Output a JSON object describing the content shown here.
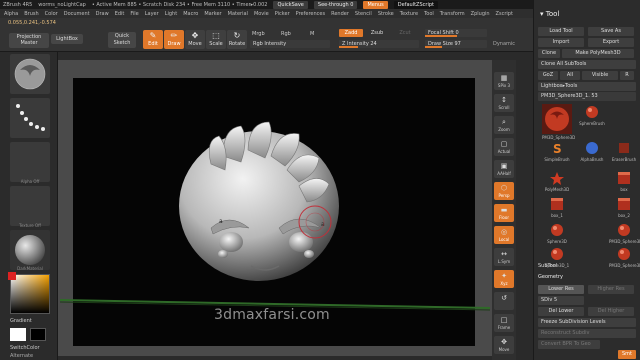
{
  "titlebar": {
    "app": "ZBrush 4R5",
    "doc": "worms_noLightCap",
    "mem": "• Active Mem 885 • Scratch Disk 234 • Free Mem 3110 • Timer▸0.002",
    "quicksave": "QuickSave",
    "seethrough": "See-through 0",
    "menus": "Menus",
    "script": "DefaultZScript"
  },
  "menubar": [
    "Alpha",
    "Brush",
    "Color",
    "Document",
    "Draw",
    "Edit",
    "File",
    "Layer",
    "Light",
    "Macro",
    "Marker",
    "Material",
    "Movie",
    "Picker",
    "Preferences",
    "Render",
    "Stencil",
    "Stroke",
    "Texture",
    "Tool",
    "Transform",
    "Zplugin",
    "Zscript"
  ],
  "coords": "0.055,0.241,-0.574",
  "shelf": {
    "projection_master": "Projection Master",
    "lightbox": "LightBox",
    "quick_sketch": "Quick Sketch",
    "tools": [
      {
        "label": "Edit",
        "icon": "✎",
        "active": true
      },
      {
        "label": "Draw",
        "icon": "✏",
        "active": true
      },
      {
        "label": "Move",
        "icon": "✥",
        "active": false
      },
      {
        "label": "Scale",
        "icon": "⬚",
        "active": false
      },
      {
        "label": "Rotate",
        "icon": "↻",
        "active": false
      }
    ],
    "mrgb": "Mrgb",
    "rgb": "Rgb",
    "m": "M",
    "zadd": "Zadd",
    "zsub": "Zsub",
    "zcut": "Zcut",
    "rgb_intensity": "Rgb Intensity",
    "z_intensity": "Z Intensity 24",
    "focal_shift": "Focal Shift 0",
    "draw_size": "Draw Size 97",
    "dynamic": "Dynamic"
  },
  "leftpanel": {
    "alpha_label": "Alpha Off",
    "texture_label": "Texture Off",
    "material_label": "DarkMaterial",
    "gradient": "Gradient",
    "switch_color": "SwitchColor",
    "alternate": "Alternate"
  },
  "rightcol": [
    {
      "label": "SPix 3",
      "icon": "▦",
      "orange": false
    },
    {
      "label": "Scroll",
      "icon": "↕",
      "orange": false
    },
    {
      "label": "Zoom",
      "icon": "⌕",
      "orange": false
    },
    {
      "label": "Actual",
      "icon": "▢",
      "orange": false
    },
    {
      "label": "AAHalf",
      "icon": "▣",
      "orange": false
    },
    {
      "label": "Persp",
      "icon": "⬡",
      "orange": true
    },
    {
      "label": "Floor",
      "icon": "▬",
      "orange": true
    },
    {
      "label": "Local",
      "icon": "◎",
      "orange": true
    },
    {
      "label": "L.Sym",
      "icon": "↔",
      "orange": false
    },
    {
      "label": "Xyz",
      "icon": "✦",
      "orange": true
    },
    {
      "label": "",
      "icon": "↺",
      "orange": false
    },
    {
      "label": "Frame",
      "icon": "□",
      "orange": false
    },
    {
      "label": "Move",
      "icon": "✥",
      "orange": false
    }
  ],
  "watermark": "3dmaxfarsi.com",
  "toolpanel": {
    "title": "Tool",
    "load_tool": "Load Tool",
    "save_as": "Save As",
    "import": "Import",
    "export": "Export",
    "clone": "Clone",
    "make_polymesh": "Make PolyMesh3D",
    "clone_all": "Clone All SubTools",
    "goz": "GoZ",
    "all": "All",
    "visible": "Visible",
    "r": "R",
    "lightbox_tools": "Lightbox▸Tools",
    "current_tool": "PM3D_Sphere3D_1. 53",
    "tools": [
      {
        "label": "PM3D_Sphere3D",
        "kind": "current"
      },
      {
        "label": "SphereBrush",
        "kind": "sphere"
      },
      {
        "label": "AlphaBrush",
        "kind": "alpha"
      },
      {
        "label": "SimpleBrush",
        "kind": "s"
      },
      {
        "label": "EraserBrush",
        "kind": "eraser"
      },
      {
        "label": "PolyMesh3D",
        "kind": "star"
      },
      {
        "label": "box",
        "kind": "box"
      },
      {
        "label": "box_1",
        "kind": "box"
      },
      {
        "label": "box_2",
        "kind": "box"
      },
      {
        "label": "Sphere3D",
        "kind": "sphere"
      },
      {
        "label": "PM3D_Sphere3D",
        "kind": "sphere"
      },
      {
        "label": "Sphere3D_1",
        "kind": "sphere"
      },
      {
        "label": "PM3D_Sphere3D",
        "kind": "sphere"
      }
    ],
    "subtool": "SubTool",
    "geometry": "Geometry",
    "lower_res": "Lower Res",
    "higher_res": "Higher Res",
    "sdiv": "SDiv 5",
    "del_lower": "Del Lower",
    "del_higher": "Del Higher",
    "freeze": "Freeze SubDivision Levels",
    "reconstruct": "Reconstruct Subdiv",
    "convert": "Convert BPR To Geo",
    "smt": "Smt"
  },
  "colors": {
    "accent": "#e0782a",
    "bg": "#2a2a2a",
    "canvas": "#050505"
  }
}
